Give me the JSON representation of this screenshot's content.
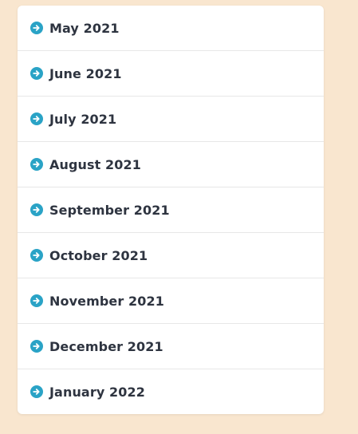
{
  "colors": {
    "background": "#f9e6cf",
    "card": "#ffffff",
    "icon": "#2aa3c6",
    "text": "#2e3440",
    "divider": "#e7e7e7"
  },
  "archive": {
    "icon": "arrow-right-circle-icon",
    "items": [
      {
        "label": "May 2021"
      },
      {
        "label": "June 2021"
      },
      {
        "label": "July 2021"
      },
      {
        "label": "August 2021"
      },
      {
        "label": "September 2021"
      },
      {
        "label": "October 2021"
      },
      {
        "label": "November 2021"
      },
      {
        "label": "December 2021"
      },
      {
        "label": "January 2022"
      }
    ]
  }
}
